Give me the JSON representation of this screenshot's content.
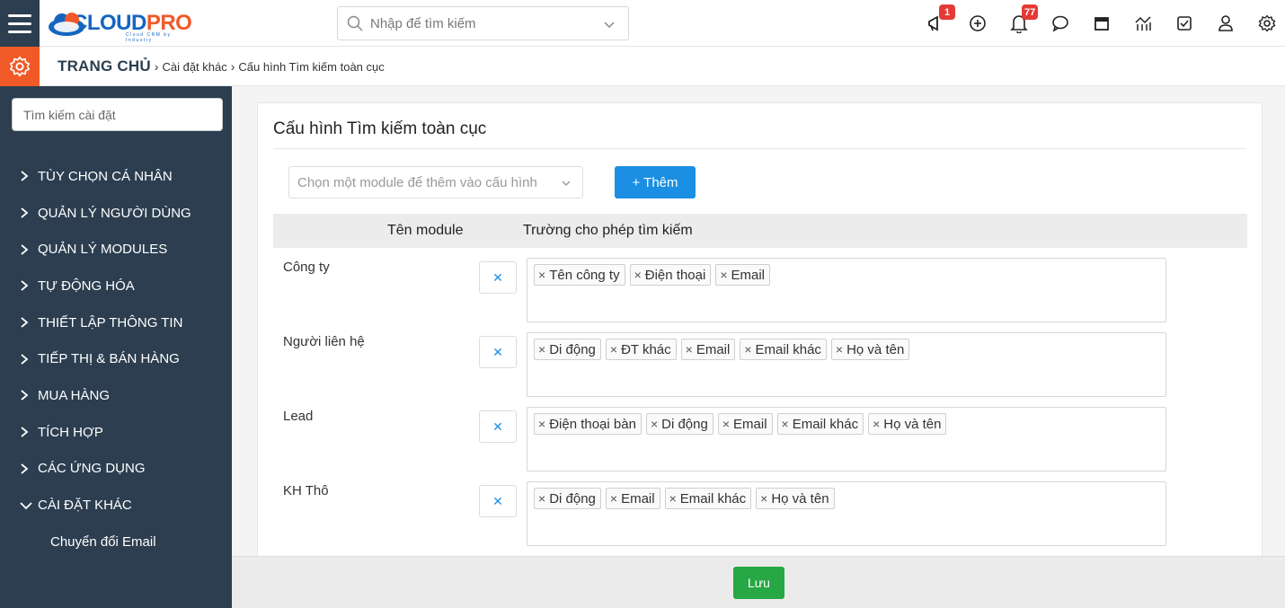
{
  "brand": {
    "part1": "CLOUD",
    "part2": "PRO",
    "tagline": "Cloud CRM by Industry"
  },
  "search": {
    "placeholder": "Nhập để tìm kiếm"
  },
  "badges": {
    "announcements": "1",
    "notifications": "77"
  },
  "breadcrumb": {
    "home": "TRANG CHỦ",
    "items": [
      "Cài đặt khác",
      "Cấu hình Tìm kiếm toàn cục"
    ]
  },
  "sidebar": {
    "search_placeholder": "Tìm kiếm cài đặt",
    "items": [
      {
        "label": "TÙY CHỌN CÁ NHÂN"
      },
      {
        "label": "QUẢN LÝ NGƯỜI DÙNG"
      },
      {
        "label": "QUẢN LÝ MODULES"
      },
      {
        "label": "TỰ ĐỘNG HÓA"
      },
      {
        "label": "THIẾT LẬP THÔNG TIN"
      },
      {
        "label": "TIẾP THỊ & BÁN HÀNG"
      },
      {
        "label": "MUA HÀNG"
      },
      {
        "label": "TÍCH HỢP"
      },
      {
        "label": "CÁC ỨNG DỤNG"
      },
      {
        "label": "CÀI ĐẶT KHÁC"
      }
    ],
    "subitem": "Chuyển đổi Email"
  },
  "main": {
    "title": "Cấu hình Tìm kiếm toàn cục",
    "module_select_placeholder": "Chọn một module để thêm vào cấu hình",
    "add_button": "+ Thêm",
    "columns": {
      "module": "Tên module",
      "fields": "Trường cho phép tìm kiếm"
    },
    "rows": [
      {
        "module": "Công ty",
        "fields": [
          "Tên công ty",
          "Điện thoại",
          "Email"
        ]
      },
      {
        "module": "Người liên hệ",
        "fields": [
          "Di động",
          "ĐT khác",
          "Email",
          "Email khác",
          "Họ và tên"
        ]
      },
      {
        "module": "Lead",
        "fields": [
          "Điện thoại bàn",
          "Di động",
          "Email",
          "Email khác",
          "Họ và tên"
        ]
      },
      {
        "module": "KH Thô",
        "fields": [
          "Di động",
          "Email",
          "Email khác",
          "Họ và tên"
        ]
      }
    ],
    "save_button": "Lưu"
  },
  "colors": {
    "sidebar": "#2c3e50",
    "accent": "#f05a28",
    "primary": "#1a8fe3",
    "success": "#28a745"
  }
}
